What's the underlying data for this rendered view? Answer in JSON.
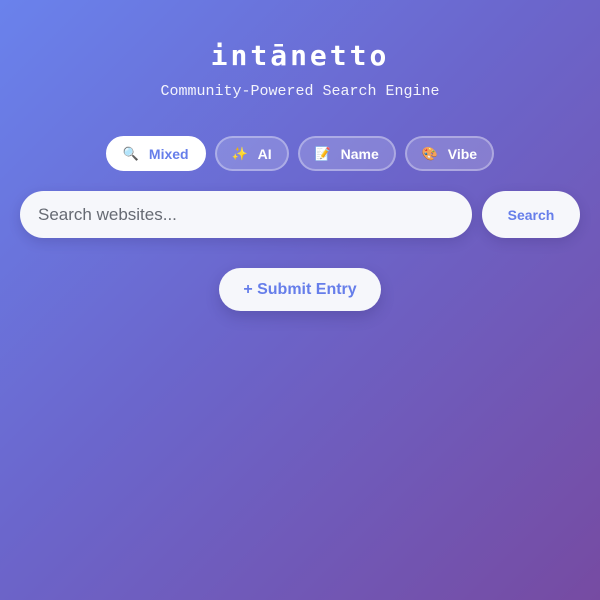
{
  "header": {
    "logo": "intānetto",
    "tagline": "Community-Powered Search Engine"
  },
  "modes": [
    {
      "label": "Mixed",
      "icon": "🔍",
      "icon_name": "magnifier-icon",
      "active": true
    },
    {
      "label": "AI",
      "icon": "✨",
      "icon_name": "sparkles-icon",
      "active": false
    },
    {
      "label": "Name",
      "icon": "📝",
      "icon_name": "memo-icon",
      "active": false
    },
    {
      "label": "Vibe",
      "icon": "🎨",
      "icon_name": "palette-icon",
      "active": false
    }
  ],
  "search": {
    "placeholder": "Search websites...",
    "value": "",
    "button_label": "Search"
  },
  "submit": {
    "label": "+ Submit Entry"
  },
  "colors": {
    "gradient_start": "#6a82ec",
    "gradient_end": "#764ba2",
    "accent": "#667eea",
    "surface": "#f6f7fb"
  }
}
